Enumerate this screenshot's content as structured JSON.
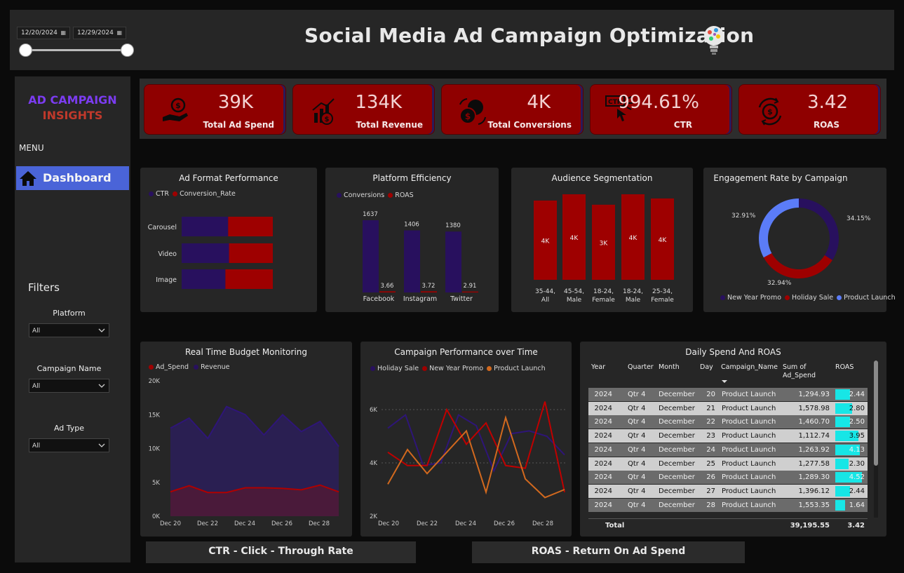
{
  "header": {
    "title": "Social Media Ad Campaign Optimization",
    "date_start": "12/20/2024",
    "date_end": "12/29/2024"
  },
  "sidebar": {
    "brand_line1": "AD CAMPAIGN",
    "brand_line2": "INSIGHTS",
    "menu_label": "MENU",
    "nav_dashboard": "Dashboard",
    "filters_title": "Filters",
    "filters": [
      {
        "label": "Platform",
        "value": "All"
      },
      {
        "label": "Campaign Name",
        "value": "All"
      },
      {
        "label": "Ad Type",
        "value": "All"
      }
    ]
  },
  "kpis": [
    {
      "value": "39K",
      "label": "Total Ad Spend",
      "icon": "money-hand-icon"
    },
    {
      "value": "134K",
      "label": "Total Revenue",
      "icon": "revenue-growth-icon"
    },
    {
      "value": "4K",
      "label": "Total Conversions",
      "icon": "coin-exchange-icon"
    },
    {
      "value": "994.61%",
      "label": "CTR",
      "icon": "ctr-click-icon"
    },
    {
      "value": "3.42",
      "label": "ROAS",
      "icon": "roas-cycle-icon"
    }
  ],
  "colors": {
    "purple": "#28105e",
    "red": "#9e0000",
    "light_blue": "#5b7cf7",
    "orange": "#d2691e",
    "cyan": "#17e6e6",
    "kpi_red": "#8f0000"
  },
  "ad_format": {
    "title": "Ad Format Performance",
    "legend": [
      "CTR",
      "Conversion_Rate"
    ],
    "categories": [
      "Carousel",
      "Video",
      "Image"
    ],
    "ctr": [
      0.51,
      0.52,
      0.48
    ],
    "conv": [
      0.49,
      0.48,
      0.52
    ]
  },
  "platform_eff": {
    "title": "Platform Efficiency",
    "legend": [
      "Conversions",
      "ROAS"
    ],
    "categories": [
      "Facebook",
      "Instagram",
      "Twitter"
    ],
    "conversions": [
      1637,
      1406,
      1380
    ],
    "roas": [
      3.66,
      3.72,
      2.91
    ]
  },
  "audience": {
    "title": "Audience Segmentation",
    "categories": [
      "35-44, All",
      "45-54, Male",
      "18-24, Female",
      "18-24, Male",
      "25-34, Female"
    ],
    "values": [
      3.8,
      4.1,
      3.6,
      4.1,
      3.9
    ],
    "labels": [
      "4K",
      "4K",
      "3K",
      "4K",
      "4K"
    ]
  },
  "engagement": {
    "title": "Engagement Rate by Campaign",
    "legend": [
      "New Year Promo",
      "Holiday Sale",
      "Product Launch"
    ],
    "values": [
      34.15,
      32.94,
      32.91
    ],
    "labels": [
      "34.15%",
      "32.94%",
      "32.91%"
    ]
  },
  "budget": {
    "title": "Real Time Budget Monitoring",
    "legend": [
      "Ad_Spend",
      "Revenue"
    ],
    "x_labels": [
      "Dec 20",
      "Dec 22",
      "Dec 24",
      "Dec 26",
      "Dec 28"
    ],
    "y_labels": [
      "20K",
      "15K",
      "10K",
      "5K",
      "0K"
    ],
    "revenue": [
      13000,
      14500,
      11500,
      16200,
      15000,
      12000,
      15000,
      12500,
      14000,
      10300
    ],
    "ad_spend": [
      3600,
      4500,
      3500,
      3500,
      4200,
      4200,
      4100,
      3900,
      4600,
      3600
    ]
  },
  "campaign_time": {
    "title": "Campaign Performance over Time",
    "legend": [
      "Holiday Sale",
      "New Year Promo",
      "Product Launch"
    ],
    "x_labels": [
      "Dec 20",
      "Dec 22",
      "Dec 24",
      "Dec 26",
      "Dec 28"
    ],
    "y_labels": [
      "6K",
      "4K",
      "2K"
    ],
    "holiday_sale": [
      5300,
      5800,
      3900,
      4000,
      5800,
      5400,
      3700,
      5100,
      5200,
      5000,
      4300
    ],
    "new_year_promo": [
      4400,
      3900,
      3900,
      6000,
      4700,
      5500,
      3900,
      3800,
      6300,
      2900
    ],
    "product_launch": [
      3200,
      4500,
      3600,
      4400,
      5200,
      2900,
      5700,
      3400,
      2700,
      3000
    ]
  },
  "daily_table": {
    "title": "Daily Spend And ROAS",
    "columns": [
      "Year",
      "Quarter",
      "Month",
      "Day",
      "Campaign_Name",
      "Sum of Ad_Spend",
      "ROAS"
    ],
    "rows": [
      [
        "2024",
        "Qtr 4",
        "December",
        "20",
        "Product Launch",
        "1,294.93",
        "2.44"
      ],
      [
        "2024",
        "Qtr 4",
        "December",
        "21",
        "Product Launch",
        "1,578.98",
        "2.80"
      ],
      [
        "2024",
        "Qtr 4",
        "December",
        "22",
        "Product Launch",
        "1,460.70",
        "2.50"
      ],
      [
        "2024",
        "Qtr 4",
        "December",
        "23",
        "Product Launch",
        "1,112.74",
        "3.95"
      ],
      [
        "2024",
        "Qtr 4",
        "December",
        "24",
        "Product Launch",
        "1,263.92",
        "4.13"
      ],
      [
        "2024",
        "Qtr 4",
        "December",
        "25",
        "Product Launch",
        "1,277.58",
        "2.30"
      ],
      [
        "2024",
        "Qtr 4",
        "December",
        "26",
        "Product Launch",
        "1,289.30",
        "4.52"
      ],
      [
        "2024",
        "Qtr 4",
        "December",
        "27",
        "Product Launch",
        "1,396.12",
        "2.44"
      ],
      [
        "2024",
        "Qtr 4",
        "December",
        "28",
        "Product Launch",
        "1,553.35",
        "1.64"
      ]
    ],
    "total_label": "Total",
    "total_spend": "39,195.55",
    "total_roas": "3.42"
  },
  "footer": {
    "ctr_note": "CTR - Click - Through Rate",
    "roas_note": "ROAS - Return On Ad Spend"
  }
}
